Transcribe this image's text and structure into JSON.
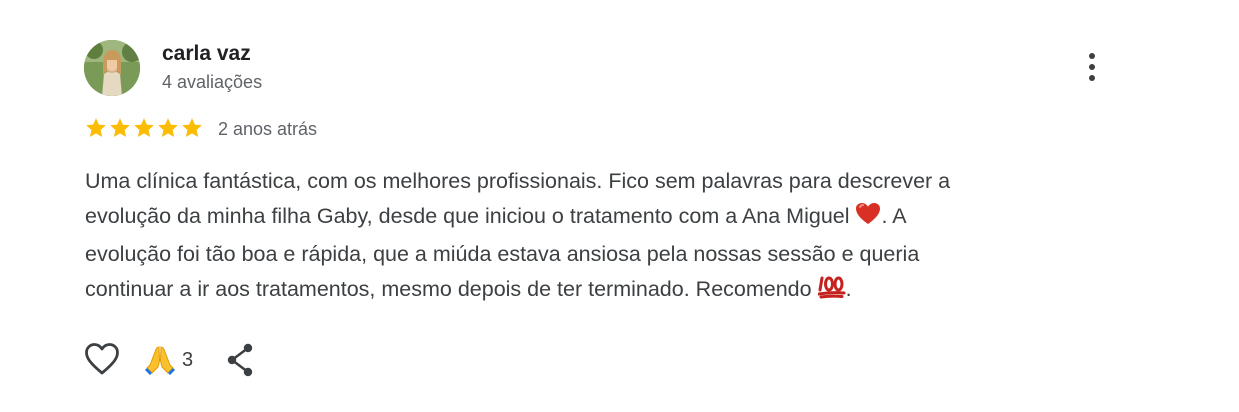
{
  "review": {
    "author": {
      "name": "carla vaz",
      "reviews_count": "4 avaliações"
    },
    "rating": {
      "stars": 5,
      "max": 5,
      "color": "#fbbc04"
    },
    "date": "2 anos atrás",
    "text": {
      "line1": "Uma clínica fantástica, com os melhores profissionais. Fico sem palavras para descrever a",
      "line2_start": "evolução da minha filha Gaby, desde que iniciou o tratamento com a Ana Miguel ",
      "line2_end": ". A",
      "line3": "evolução foi tão boa e rápida, que a miúda estava ansiosa pela nossas sessão e queria",
      "line4_start": "continuar a ir aos tratamentos, mesmo depois de ter terminado. Recomendo ",
      "line4_end": "."
    },
    "inline_emojis": [
      "heart-emoji",
      "hundred-points-emoji"
    ],
    "actions": {
      "like_icon": "heart-outline-icon",
      "reaction_icon": "folded-hands-emoji",
      "reaction_count": "3",
      "share_icon": "share-icon",
      "more_icon": "more-vertical-icon"
    }
  }
}
